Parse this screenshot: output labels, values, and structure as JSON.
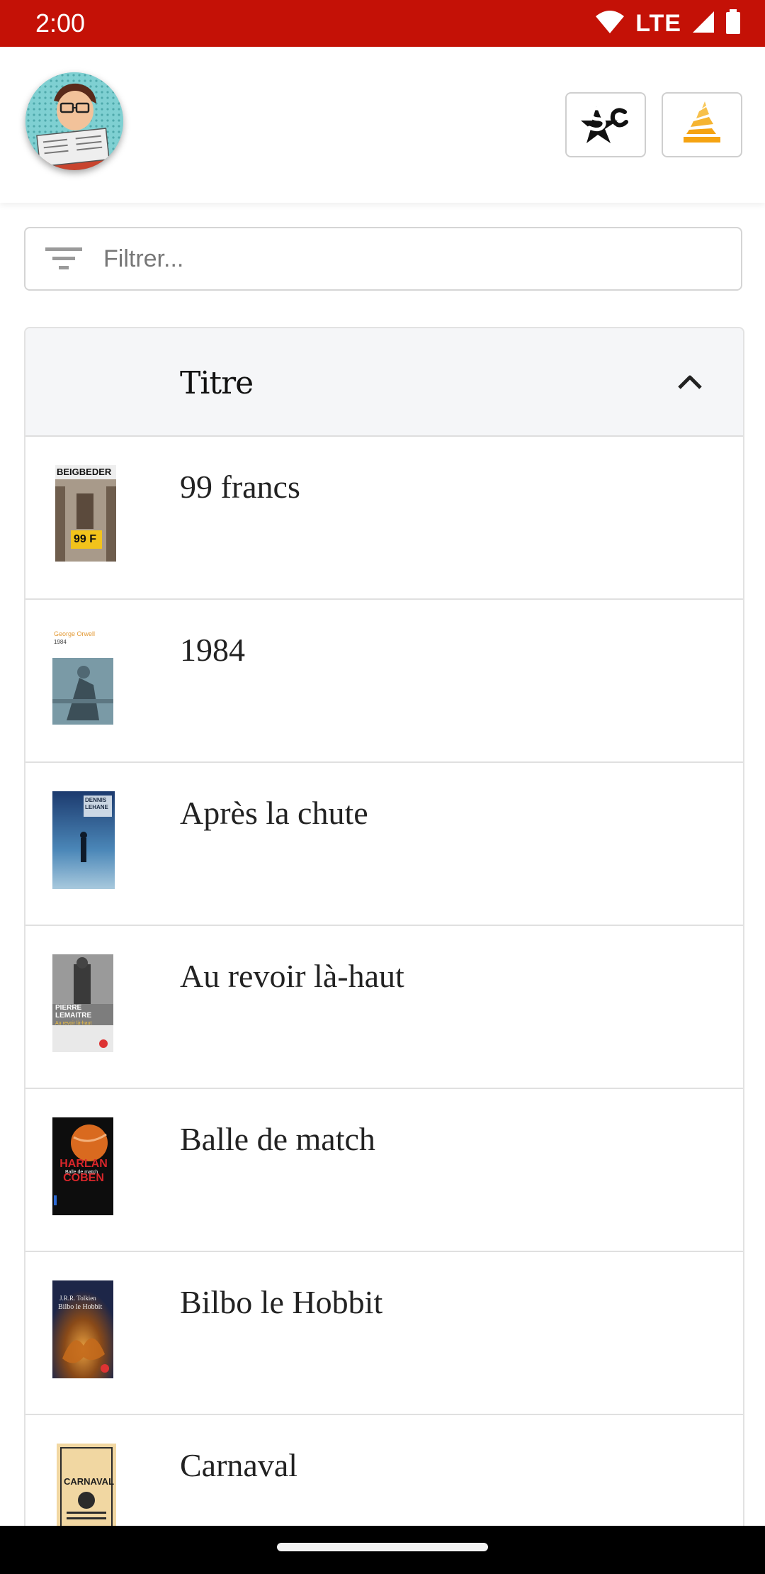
{
  "status_bar": {
    "time": "2:00",
    "network": "LTE",
    "background_color": "#c41106"
  },
  "header": {
    "avatar_icon": "reader-avatar-icon",
    "buttons": [
      {
        "icon": "senscritique-logo-icon"
      },
      {
        "icon": "stack-overflow-icon"
      }
    ]
  },
  "filter": {
    "placeholder": "Filtrer...",
    "icon": "filter-icon"
  },
  "table": {
    "column_header": "Titre",
    "sort_icon": "chevron-up-icon",
    "rows": [
      {
        "title": "99 francs",
        "cover_text": "BEIGBEDER",
        "cover_badge": "99 F"
      },
      {
        "title": "1984",
        "cover_text": "George Orwell",
        "cover_sub": "1984"
      },
      {
        "title": "Après la chute",
        "cover_text": "DENNIS LEHANE"
      },
      {
        "title": "Au revoir là-haut",
        "cover_text": "PIERRE LEMAITRE",
        "cover_sub": "Au revoir là-haut"
      },
      {
        "title": "Balle de match",
        "cover_text": "HARLAN COBEN",
        "cover_sub": "Balle de match"
      },
      {
        "title": "Bilbo le Hobbit",
        "cover_text": "J.R.R. Tolkien",
        "cover_sub": "Bilbo le Hobbit"
      },
      {
        "title": "Carnaval",
        "cover_text": "CARNAVAL"
      }
    ]
  }
}
